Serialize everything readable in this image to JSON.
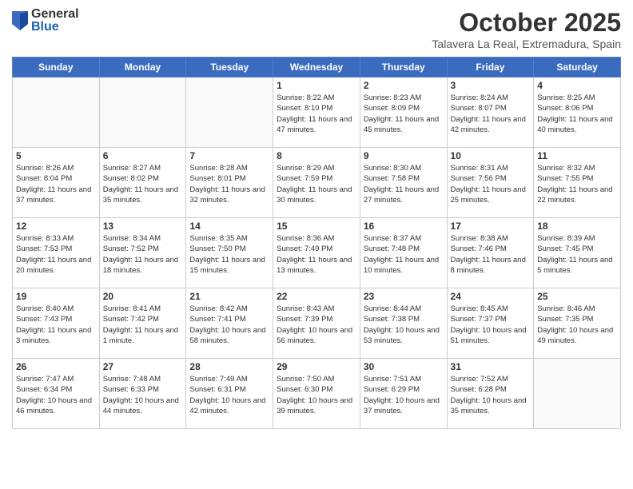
{
  "logo": {
    "general": "General",
    "blue": "Blue"
  },
  "title": "October 2025",
  "location": "Talavera La Real, Extremadura, Spain",
  "days_of_week": [
    "Sunday",
    "Monday",
    "Tuesday",
    "Wednesday",
    "Thursday",
    "Friday",
    "Saturday"
  ],
  "weeks": [
    [
      {
        "day": "",
        "info": ""
      },
      {
        "day": "",
        "info": ""
      },
      {
        "day": "",
        "info": ""
      },
      {
        "day": "1",
        "info": "Sunrise: 8:22 AM\nSunset: 8:10 PM\nDaylight: 11 hours and 47 minutes."
      },
      {
        "day": "2",
        "info": "Sunrise: 8:23 AM\nSunset: 8:09 PM\nDaylight: 11 hours and 45 minutes."
      },
      {
        "day": "3",
        "info": "Sunrise: 8:24 AM\nSunset: 8:07 PM\nDaylight: 11 hours and 42 minutes."
      },
      {
        "day": "4",
        "info": "Sunrise: 8:25 AM\nSunset: 8:06 PM\nDaylight: 11 hours and 40 minutes."
      }
    ],
    [
      {
        "day": "5",
        "info": "Sunrise: 8:26 AM\nSunset: 8:04 PM\nDaylight: 11 hours and 37 minutes."
      },
      {
        "day": "6",
        "info": "Sunrise: 8:27 AM\nSunset: 8:02 PM\nDaylight: 11 hours and 35 minutes."
      },
      {
        "day": "7",
        "info": "Sunrise: 8:28 AM\nSunset: 8:01 PM\nDaylight: 11 hours and 32 minutes."
      },
      {
        "day": "8",
        "info": "Sunrise: 8:29 AM\nSunset: 7:59 PM\nDaylight: 11 hours and 30 minutes."
      },
      {
        "day": "9",
        "info": "Sunrise: 8:30 AM\nSunset: 7:58 PM\nDaylight: 11 hours and 27 minutes."
      },
      {
        "day": "10",
        "info": "Sunrise: 8:31 AM\nSunset: 7:56 PM\nDaylight: 11 hours and 25 minutes."
      },
      {
        "day": "11",
        "info": "Sunrise: 8:32 AM\nSunset: 7:55 PM\nDaylight: 11 hours and 22 minutes."
      }
    ],
    [
      {
        "day": "12",
        "info": "Sunrise: 8:33 AM\nSunset: 7:53 PM\nDaylight: 11 hours and 20 minutes."
      },
      {
        "day": "13",
        "info": "Sunrise: 8:34 AM\nSunset: 7:52 PM\nDaylight: 11 hours and 18 minutes."
      },
      {
        "day": "14",
        "info": "Sunrise: 8:35 AM\nSunset: 7:50 PM\nDaylight: 11 hours and 15 minutes."
      },
      {
        "day": "15",
        "info": "Sunrise: 8:36 AM\nSunset: 7:49 PM\nDaylight: 11 hours and 13 minutes."
      },
      {
        "day": "16",
        "info": "Sunrise: 8:37 AM\nSunset: 7:48 PM\nDaylight: 11 hours and 10 minutes."
      },
      {
        "day": "17",
        "info": "Sunrise: 8:38 AM\nSunset: 7:46 PM\nDaylight: 11 hours and 8 minutes."
      },
      {
        "day": "18",
        "info": "Sunrise: 8:39 AM\nSunset: 7:45 PM\nDaylight: 11 hours and 5 minutes."
      }
    ],
    [
      {
        "day": "19",
        "info": "Sunrise: 8:40 AM\nSunset: 7:43 PM\nDaylight: 11 hours and 3 minutes."
      },
      {
        "day": "20",
        "info": "Sunrise: 8:41 AM\nSunset: 7:42 PM\nDaylight: 11 hours and 1 minute."
      },
      {
        "day": "21",
        "info": "Sunrise: 8:42 AM\nSunset: 7:41 PM\nDaylight: 10 hours and 58 minutes."
      },
      {
        "day": "22",
        "info": "Sunrise: 8:43 AM\nSunset: 7:39 PM\nDaylight: 10 hours and 56 minutes."
      },
      {
        "day": "23",
        "info": "Sunrise: 8:44 AM\nSunset: 7:38 PM\nDaylight: 10 hours and 53 minutes."
      },
      {
        "day": "24",
        "info": "Sunrise: 8:45 AM\nSunset: 7:37 PM\nDaylight: 10 hours and 51 minutes."
      },
      {
        "day": "25",
        "info": "Sunrise: 8:46 AM\nSunset: 7:35 PM\nDaylight: 10 hours and 49 minutes."
      }
    ],
    [
      {
        "day": "26",
        "info": "Sunrise: 7:47 AM\nSunset: 6:34 PM\nDaylight: 10 hours and 46 minutes."
      },
      {
        "day": "27",
        "info": "Sunrise: 7:48 AM\nSunset: 6:33 PM\nDaylight: 10 hours and 44 minutes."
      },
      {
        "day": "28",
        "info": "Sunrise: 7:49 AM\nSunset: 6:31 PM\nDaylight: 10 hours and 42 minutes."
      },
      {
        "day": "29",
        "info": "Sunrise: 7:50 AM\nSunset: 6:30 PM\nDaylight: 10 hours and 39 minutes."
      },
      {
        "day": "30",
        "info": "Sunrise: 7:51 AM\nSunset: 6:29 PM\nDaylight: 10 hours and 37 minutes."
      },
      {
        "day": "31",
        "info": "Sunrise: 7:52 AM\nSunset: 6:28 PM\nDaylight: 10 hours and 35 minutes."
      },
      {
        "day": "",
        "info": ""
      }
    ]
  ]
}
